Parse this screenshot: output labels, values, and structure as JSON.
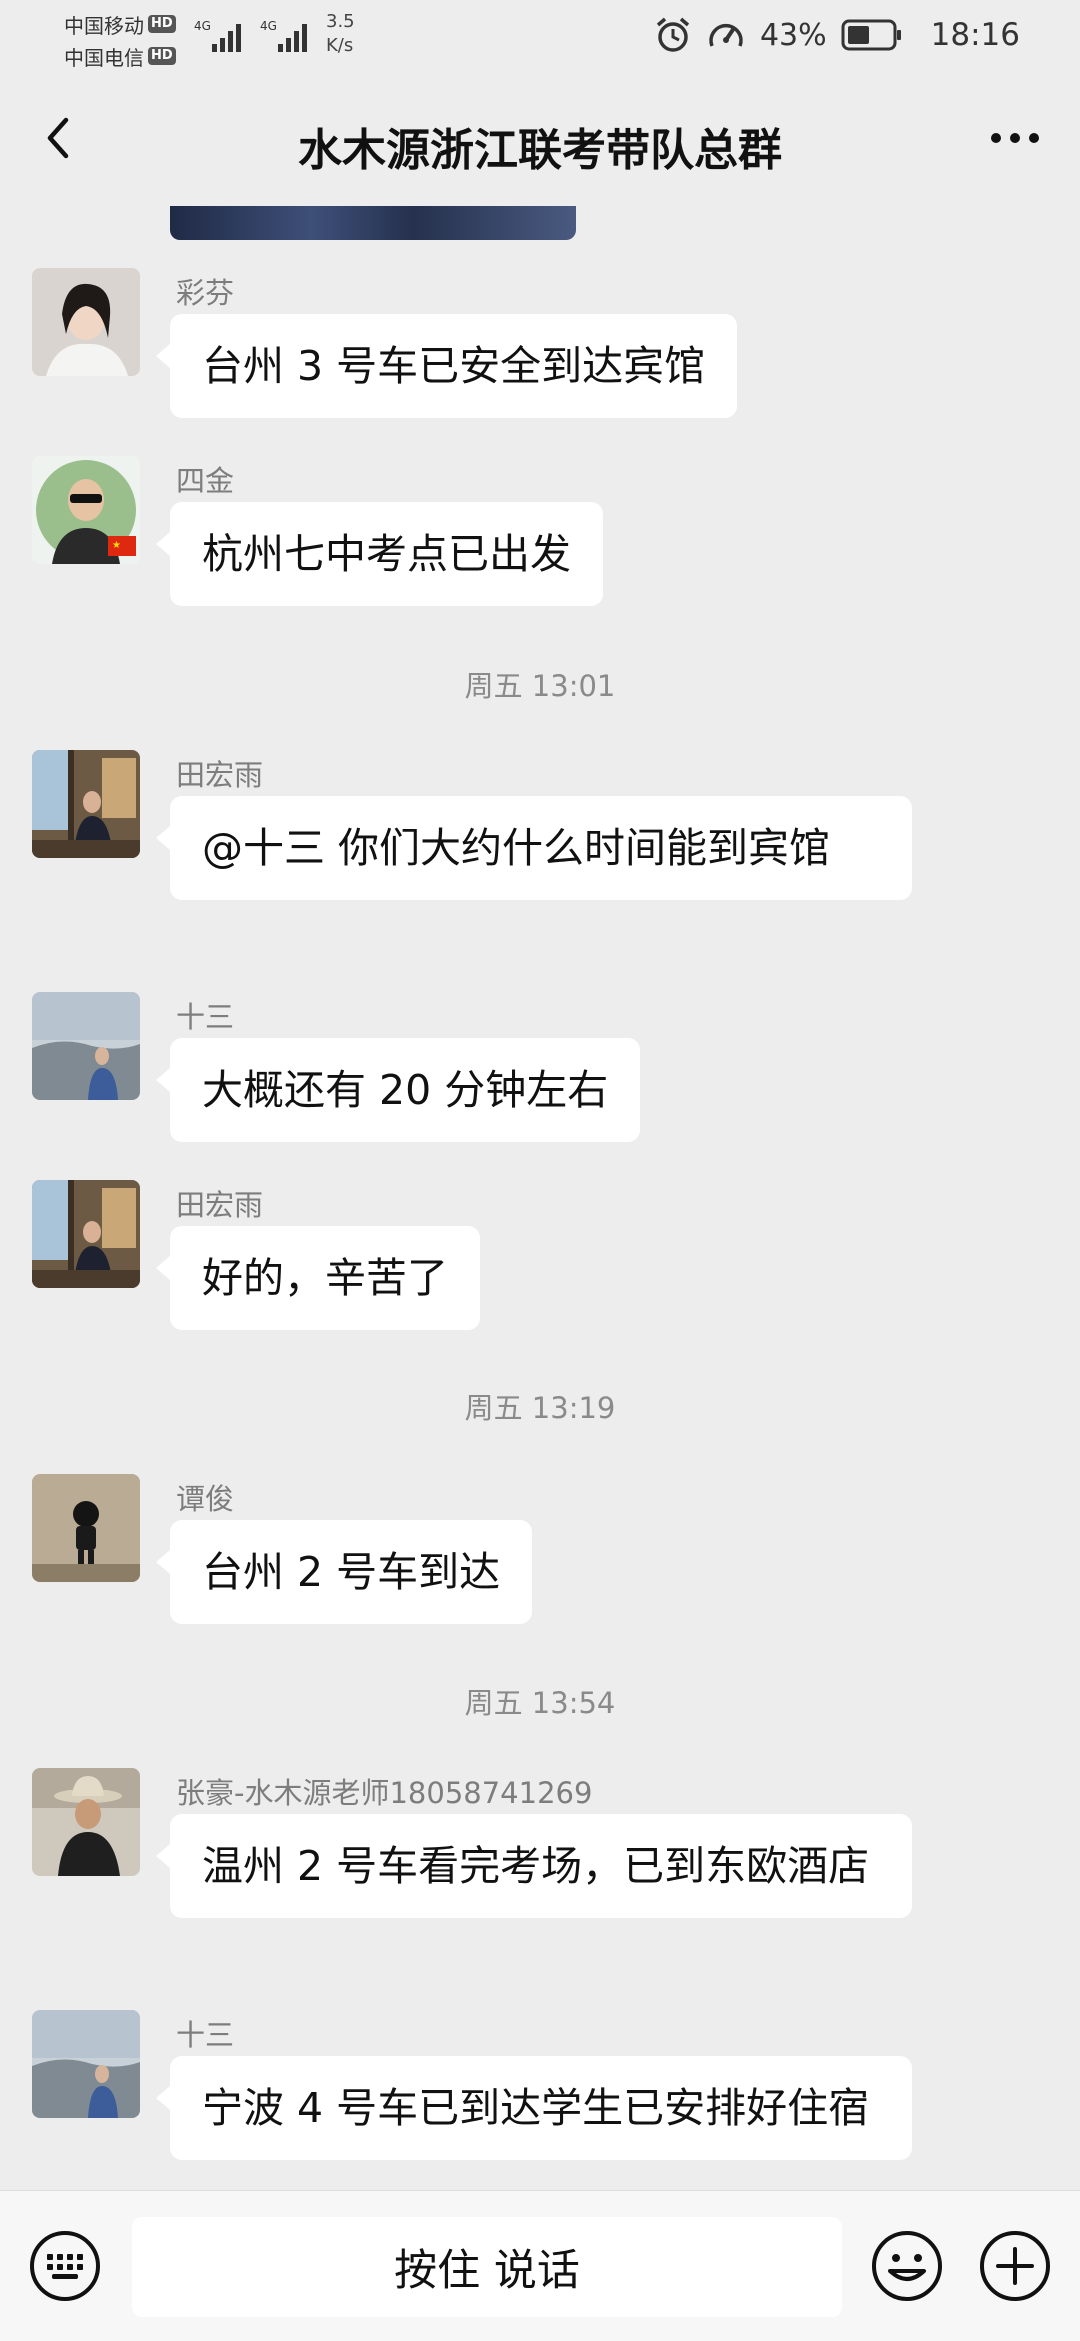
{
  "status_bar": {
    "carrier1": "中国移动",
    "carrier2": "中国电信",
    "hd": "HD",
    "network1": "4G",
    "network2": "4G",
    "speed_value": "3.5",
    "speed_unit": "K/s",
    "battery": "43%",
    "time": "18:16"
  },
  "header": {
    "title": "水木源浙江联考带队总群"
  },
  "messages": [
    {
      "sender": "彩芬",
      "text": "台州 3 号车已安全到达宾馆",
      "avatar_icon": "avatar-woman-icon"
    },
    {
      "sender": "四金",
      "text": "杭州七中考点已出发",
      "avatar_icon": "avatar-man-sunglasses-icon"
    },
    {
      "sender": "田宏雨",
      "text": "@十三  你们大约什么时间能到宾馆",
      "avatar_icon": "avatar-hotel-room-icon"
    },
    {
      "sender": "十三",
      "text": "大概还有 20 分钟左右",
      "avatar_icon": "avatar-seaside-icon"
    },
    {
      "sender": "田宏雨",
      "text": "好的，辛苦了",
      "avatar_icon": "avatar-hotel-room-icon"
    },
    {
      "sender": "谭俊",
      "text": "台州 2 号车到达",
      "avatar_icon": "avatar-figurine-icon"
    },
    {
      "sender": "张豪-水木源老师18058741269",
      "text": "温州 2 号车看完考场，已到东欧酒店",
      "avatar_icon": "avatar-cowboy-hat-icon"
    },
    {
      "sender": "十三",
      "text": "宁波 4 号车已到达学生已安排好住宿",
      "avatar_icon": "avatar-seaside-icon"
    }
  ],
  "timestamps": [
    "周五 13:01",
    "周五 13:19",
    "周五 13:54"
  ],
  "input_bar": {
    "voice_label": "按住 说话"
  }
}
